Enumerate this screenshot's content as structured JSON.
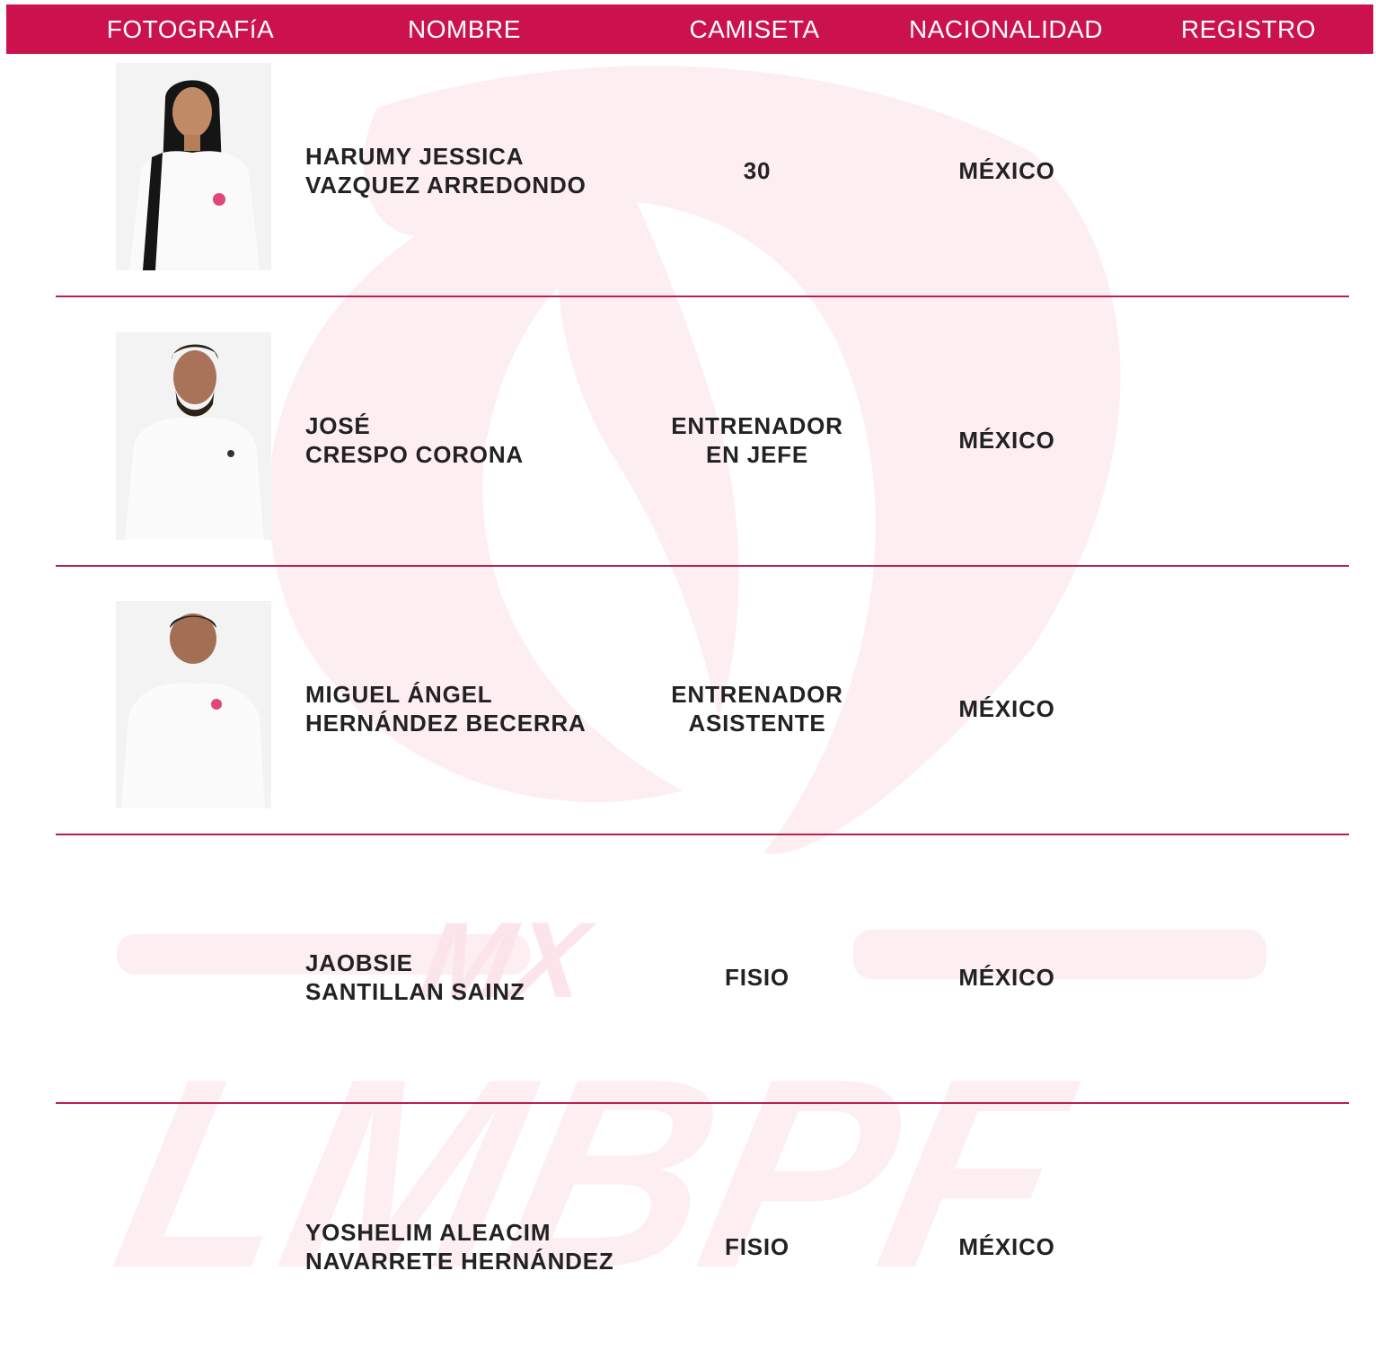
{
  "colors": {
    "accent": "#cc124d",
    "divider": "#b8204e",
    "text": "#222222",
    "watermark": "#fdeef2"
  },
  "header": {
    "photo": "FOTOGRAFíA",
    "name": "NOMBRE",
    "shirt": "CAMISETA",
    "nationality": "NACIONALIDAD",
    "registry": "REGISTRO"
  },
  "watermark": {
    "mx": "MX",
    "brand": "LMBPF"
  },
  "rows": [
    {
      "name_line1": "HARUMY JESSICA",
      "name_line2": "VAZQUEZ ARREDONDO",
      "shirt_line1": "30",
      "shirt_line2": "",
      "nationality": "MÉXICO",
      "photo": "player-photo"
    },
    {
      "name_line1": "JOSÉ",
      "name_line2": "CRESPO CORONA",
      "shirt_line1": "ENTRENADOR",
      "shirt_line2": "EN JEFE",
      "nationality": "MÉXICO",
      "photo": "coach-photo"
    },
    {
      "name_line1": "MIGUEL ÁNGEL",
      "name_line2": "HERNÁNDEZ BECERRA",
      "shirt_line1": "ENTRENADOR",
      "shirt_line2": "ASISTENTE",
      "nationality": "MÉXICO",
      "photo": "assistant-photo"
    },
    {
      "name_line1": "JAOBSIE",
      "name_line2": "SANTILLAN SAINZ",
      "shirt_line1": "FISIO",
      "shirt_line2": "",
      "nationality": "MÉXICO",
      "photo": ""
    },
    {
      "name_line1": "YOSHELIM ALEACIM",
      "name_line2": "NAVARRETE HERNÁNDEZ",
      "shirt_line1": "FISIO",
      "shirt_line2": "",
      "nationality": "MÉXICO",
      "photo": ""
    }
  ]
}
